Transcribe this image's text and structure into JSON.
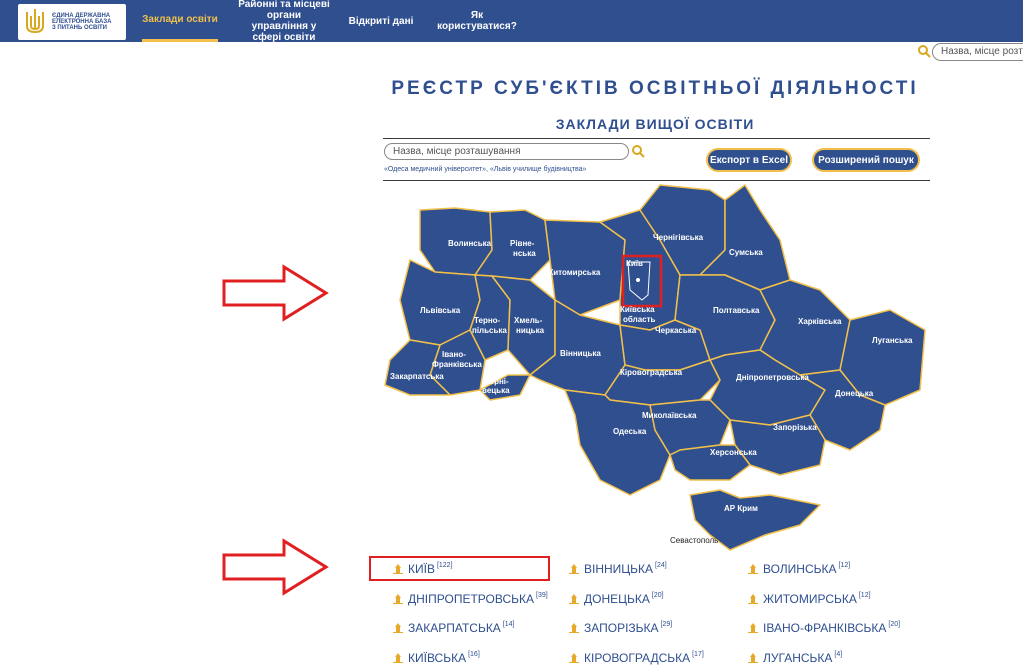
{
  "header": {
    "logo_text": "Єдина державна електронна база з питань освіти",
    "nav": [
      {
        "label": "Заклади освіти",
        "active": true
      },
      {
        "label": "Районні та місцеві органи управління у сфері освіти",
        "active": false
      },
      {
        "label": "Відкриті дані",
        "active": false
      },
      {
        "label": "Як користуватися?",
        "active": false
      }
    ],
    "search_placeholder": "Назва, місце розт"
  },
  "main": {
    "title": "РЕЄСТР СУБ'ЄКТІВ ОСВІТНЬОЇ ДІЯЛЬНОСТІ",
    "subtitle": "ЗАКЛАДИ ВИЩОЇ ОСВІТИ",
    "search_placeholder": "Назва, місце розташування",
    "examples": "«Одеса медичний університет», «Львів училище будівництва»",
    "export_label": "Експорт в Excel",
    "advanced_label": "Розширений пошук"
  },
  "map": {
    "fill": "#2f4f8f",
    "border": "#f2c04a",
    "labels": [
      "Волинська",
      "Рівне-",
      "нська",
      "Житомирська",
      "Чернігівська",
      "Сумська",
      "Київ",
      "Київська",
      "область",
      "Львівська",
      "Терно-",
      "пільська",
      "Хмель-",
      "ницька",
      "Вінницька",
      "Черкаська",
      "Полтавська",
      "Харківська",
      "Луганська",
      "Івано-",
      "Франківська",
      "Закарпатська",
      "Черні-",
      "вецька",
      "Кіровоградська",
      "Дніпропетровська",
      "Донецька",
      "Миколаївська",
      "Запорізька",
      "Одеська",
      "Херсонська",
      "АР Крим",
      "Севастополь"
    ]
  },
  "regions": [
    {
      "name": "КИЇВ",
      "count": "[122]"
    },
    {
      "name": "ВІННИЦЬКА",
      "count": "[24]"
    },
    {
      "name": "ВОЛИНСЬКА",
      "count": "[12]"
    },
    {
      "name": "ДНІПРОПЕТРОВСЬКА",
      "count": "[39]"
    },
    {
      "name": "ДОНЕЦЬКА",
      "count": "[20]"
    },
    {
      "name": "ЖИТОМИРСЬКА",
      "count": "[12]"
    },
    {
      "name": "ЗАКАРПАТСЬКА",
      "count": "[14]"
    },
    {
      "name": "ЗАПОРІЗЬКА",
      "count": "[29]"
    },
    {
      "name": "ІВАНО-ФРАНКІВСЬКА",
      "count": "[20]"
    },
    {
      "name": "КИЇВСЬКА",
      "count": "[16]"
    },
    {
      "name": "КІРОВОГРАДСЬКА",
      "count": "[17]"
    },
    {
      "name": "ЛУГАНСЬКА",
      "count": "[4]"
    }
  ],
  "colors": {
    "primary": "#2f4f8f",
    "accent": "#f2c04a",
    "annotation": "#e02020"
  }
}
